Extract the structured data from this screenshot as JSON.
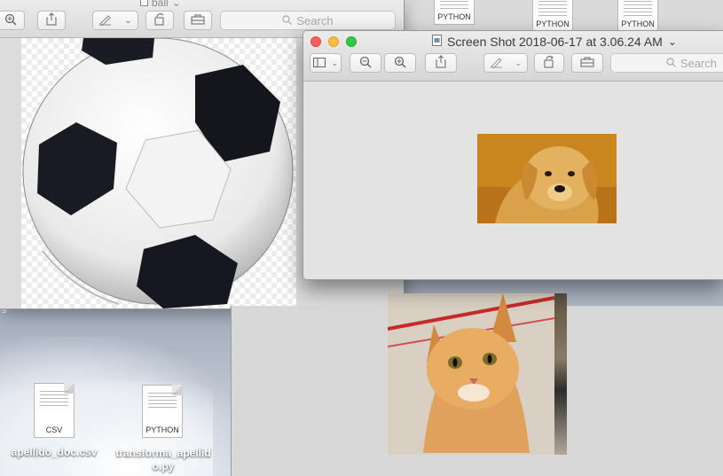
{
  "background_window": {
    "title": "ball",
    "search_placeholder": "Search"
  },
  "front_window": {
    "title": "Screen Shot 2018-06-17 at 3.06.24 AM",
    "search_placeholder": "Search"
  },
  "top_strip_docs": [
    {
      "label": "PYTHON"
    },
    {
      "label": "PYTHON"
    },
    {
      "label": "PYTHON"
    }
  ],
  "desktop_files": [
    {
      "name": "apellido_doc.csv",
      "type_label": "CSV"
    },
    {
      "name": "transforma_apellido.py",
      "line1": "transforma_apellid",
      "line2": "o.py",
      "type_label": "PYTHON"
    }
  ],
  "left_edge_text": "s",
  "colors": {
    "close": "#fc605b",
    "minimize": "#fdbc40",
    "zoom": "#34c84a",
    "dog_bg": "#c9861f",
    "cat_bg": "#c58b47"
  },
  "icons": [
    "zoom-out-icon",
    "zoom-in-icon",
    "share-icon",
    "markup-pen-icon",
    "rotate-icon",
    "toolbox-icon",
    "sidebar-icon",
    "search-icon",
    "document-icon"
  ]
}
